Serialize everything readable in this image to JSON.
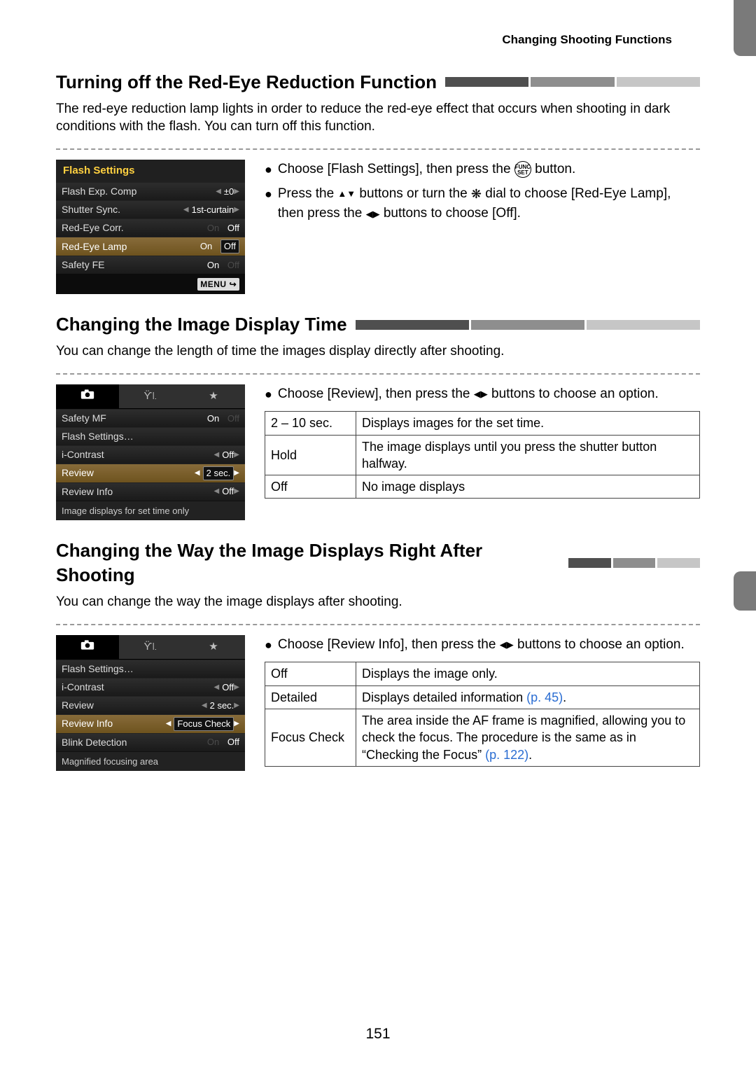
{
  "running_head": "Changing Shooting Functions",
  "page_number": "151",
  "sect1": {
    "title": "Turning off the Red-Eye Reduction Function",
    "intro": "The red-eye reduction lamp lights in order to reduce the red-eye effect that occurs when shooting in dark conditions with the flash. You can turn off this function.",
    "bul_a": "Choose [Flash Settings], then press the ",
    "bul_a2": " button.",
    "bul_b_1": "Press the ",
    "bul_b_2": " buttons or turn the ",
    "bul_b_3": " dial to choose [Red-Eye Lamp], then press the ",
    "bul_b_4": " buttons to choose [Off].",
    "funcset_top": "FUNC",
    "funcset_bot": "SET",
    "lcd": {
      "title": "Flash Settings",
      "r1": {
        "lbl": "Flash Exp. Comp",
        "v": "±0"
      },
      "r2": {
        "lbl": "Shutter Sync.",
        "v": "1st-curtain"
      },
      "r3": {
        "lbl": "Red-Eye Corr.",
        "on": "On",
        "off": "Off"
      },
      "r4": {
        "lbl": "Red-Eye Lamp",
        "on": "On",
        "off": "Off"
      },
      "r5": {
        "lbl": "Safety FE",
        "on": "On",
        "off": "Off"
      },
      "menu": "MENU"
    }
  },
  "sect2": {
    "title": "Changing the Image Display Time",
    "intro": "You can change the length of time the images display directly after shooting.",
    "bul": "Choose [Review], then press the ",
    "bul2": " buttons to choose an option.",
    "lcd": {
      "r1": {
        "lbl": "Safety MF",
        "on": "On",
        "off": "Off"
      },
      "r2": {
        "lbl": "Flash Settings…"
      },
      "r3": {
        "lbl": "i-Contrast",
        "v": "Off"
      },
      "r4": {
        "lbl": "Review",
        "v": "2 sec."
      },
      "r5": {
        "lbl": "Review Info",
        "v": "Off"
      },
      "status": "Image displays for set time only"
    },
    "table": {
      "r1k": "2 – 10 sec.",
      "r1v": "Displays images for the set time.",
      "r2k": "Hold",
      "r2v": "The image displays until you press the shutter button halfway.",
      "r3k": "Off",
      "r3v": "No image displays"
    }
  },
  "sect3": {
    "title": "Changing the Way the Image Displays Right After Shooting",
    "intro": "You can change the way the image displays after shooting.",
    "bul": "Choose [Review Info], then press the ",
    "bul2": " buttons to choose an option.",
    "lcd": {
      "r1": {
        "lbl": "Flash Settings…"
      },
      "r2": {
        "lbl": "i-Contrast",
        "v": "Off"
      },
      "r3": {
        "lbl": "Review",
        "v": "2 sec."
      },
      "r4": {
        "lbl": "Review Info",
        "v": "Focus Check"
      },
      "r5": {
        "lbl": "Blink Detection",
        "on": "On",
        "off": "Off"
      },
      "status": "Magnified focusing area"
    },
    "table": {
      "r1k": "Off",
      "r1v": "Displays the image only.",
      "r2k": "Detailed",
      "r2v_a": "Displays detailed information ",
      "r2v_link": "(p. 45)",
      "r2v_b": ".",
      "r3k": "Focus Check",
      "r3v_a": "The area inside the AF frame is magnified, allowing you to check the focus. The procedure is the same as in “Checking the Focus” ",
      "r3v_link": "(p. 122)",
      "r3v_b": "."
    }
  }
}
